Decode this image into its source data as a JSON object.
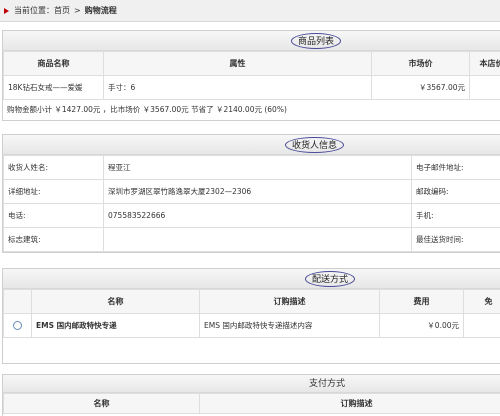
{
  "breadcrumb": {
    "prefix": "当前位置：",
    "home": "首页",
    "separator": ">",
    "current": "购物流程"
  },
  "goods": {
    "title": "商品列表",
    "headers": [
      "商品名称",
      "属性",
      "市场价",
      "本店价"
    ],
    "rows": [
      {
        "name": "18K钻石女戒——爱媛",
        "attr": "手寸：6",
        "market_price": "￥3567.00元"
      }
    ],
    "summary": "购物金额小计 ￥1427.00元 ，比市场价 ￥3567.00元 节省了 ￥2140.00元 (60%)"
  },
  "consignee": {
    "title": "收货人信息",
    "rows": [
      {
        "label": "收货人姓名:",
        "value": "程亚江",
        "label2": "电子邮件地址:"
      },
      {
        "label": "详细地址:",
        "value": "深圳市罗湖区翠竹路逸翠大厦2302—2306",
        "label2": "邮政编码:"
      },
      {
        "label": "电话:",
        "value": "075583522666",
        "label2": "手机:"
      },
      {
        "label": "标志建筑:",
        "value": "",
        "label2": "最佳送货时间:"
      }
    ]
  },
  "shipping": {
    "title": "配送方式",
    "headers": [
      "",
      "名称",
      "订购描述",
      "费用",
      "免"
    ],
    "rows": [
      {
        "name": "EMS 国内邮政特快专递",
        "desc": "EMS 国内邮政特快专递描述内容",
        "fee": "￥0.00元"
      }
    ]
  },
  "payment": {
    "title": "支付方式",
    "headers": [
      "名称",
      "订购描述"
    ]
  }
}
